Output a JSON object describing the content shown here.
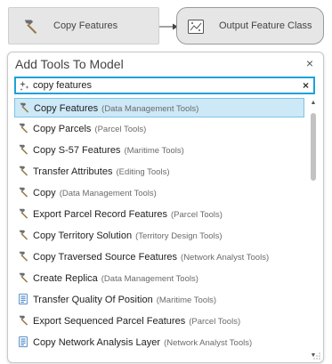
{
  "diagram": {
    "tool_node": {
      "label": "Copy Features",
      "icon": "hammer-icon"
    },
    "data_node": {
      "label": "Output Feature Class",
      "icon": "feature-class-icon"
    }
  },
  "panel": {
    "title": "Add Tools To Model",
    "close_glyph": "×",
    "search": {
      "value": "copy features",
      "clear_glyph": "×"
    }
  },
  "results": [
    {
      "name": "Copy Features",
      "toolbox": "(Data Management Tools)",
      "icon": "hammer-icon",
      "selected": true
    },
    {
      "name": "Copy Parcels",
      "toolbox": "(Parcel Tools)",
      "icon": "hammer-icon"
    },
    {
      "name": "Copy S-57 Features",
      "toolbox": "(Maritime Tools)",
      "icon": "hammer-icon"
    },
    {
      "name": "Transfer Attributes",
      "toolbox": "(Editing Tools)",
      "icon": "hammer-icon"
    },
    {
      "name": "Copy",
      "toolbox": "(Data Management Tools)",
      "icon": "hammer-icon"
    },
    {
      "name": "Export Parcel Record Features",
      "toolbox": "(Parcel Tools)",
      "icon": "hammer-icon"
    },
    {
      "name": "Copy Territory Solution",
      "toolbox": "(Territory Design Tools)",
      "icon": "hammer-icon"
    },
    {
      "name": "Copy Traversed Source Features",
      "toolbox": "(Network Analyst Tools)",
      "icon": "hammer-icon"
    },
    {
      "name": "Create Replica",
      "toolbox": "(Data Management Tools)",
      "icon": "hammer-icon"
    },
    {
      "name": "Transfer Quality Of Position",
      "toolbox": "(Maritime Tools)",
      "icon": "script-icon"
    },
    {
      "name": "Export Sequenced Parcel Features",
      "toolbox": "(Parcel Tools)",
      "icon": "hammer-icon"
    },
    {
      "name": "Copy Network Analysis Layer",
      "toolbox": "(Network Analyst Tools)",
      "icon": "script-icon"
    }
  ]
}
